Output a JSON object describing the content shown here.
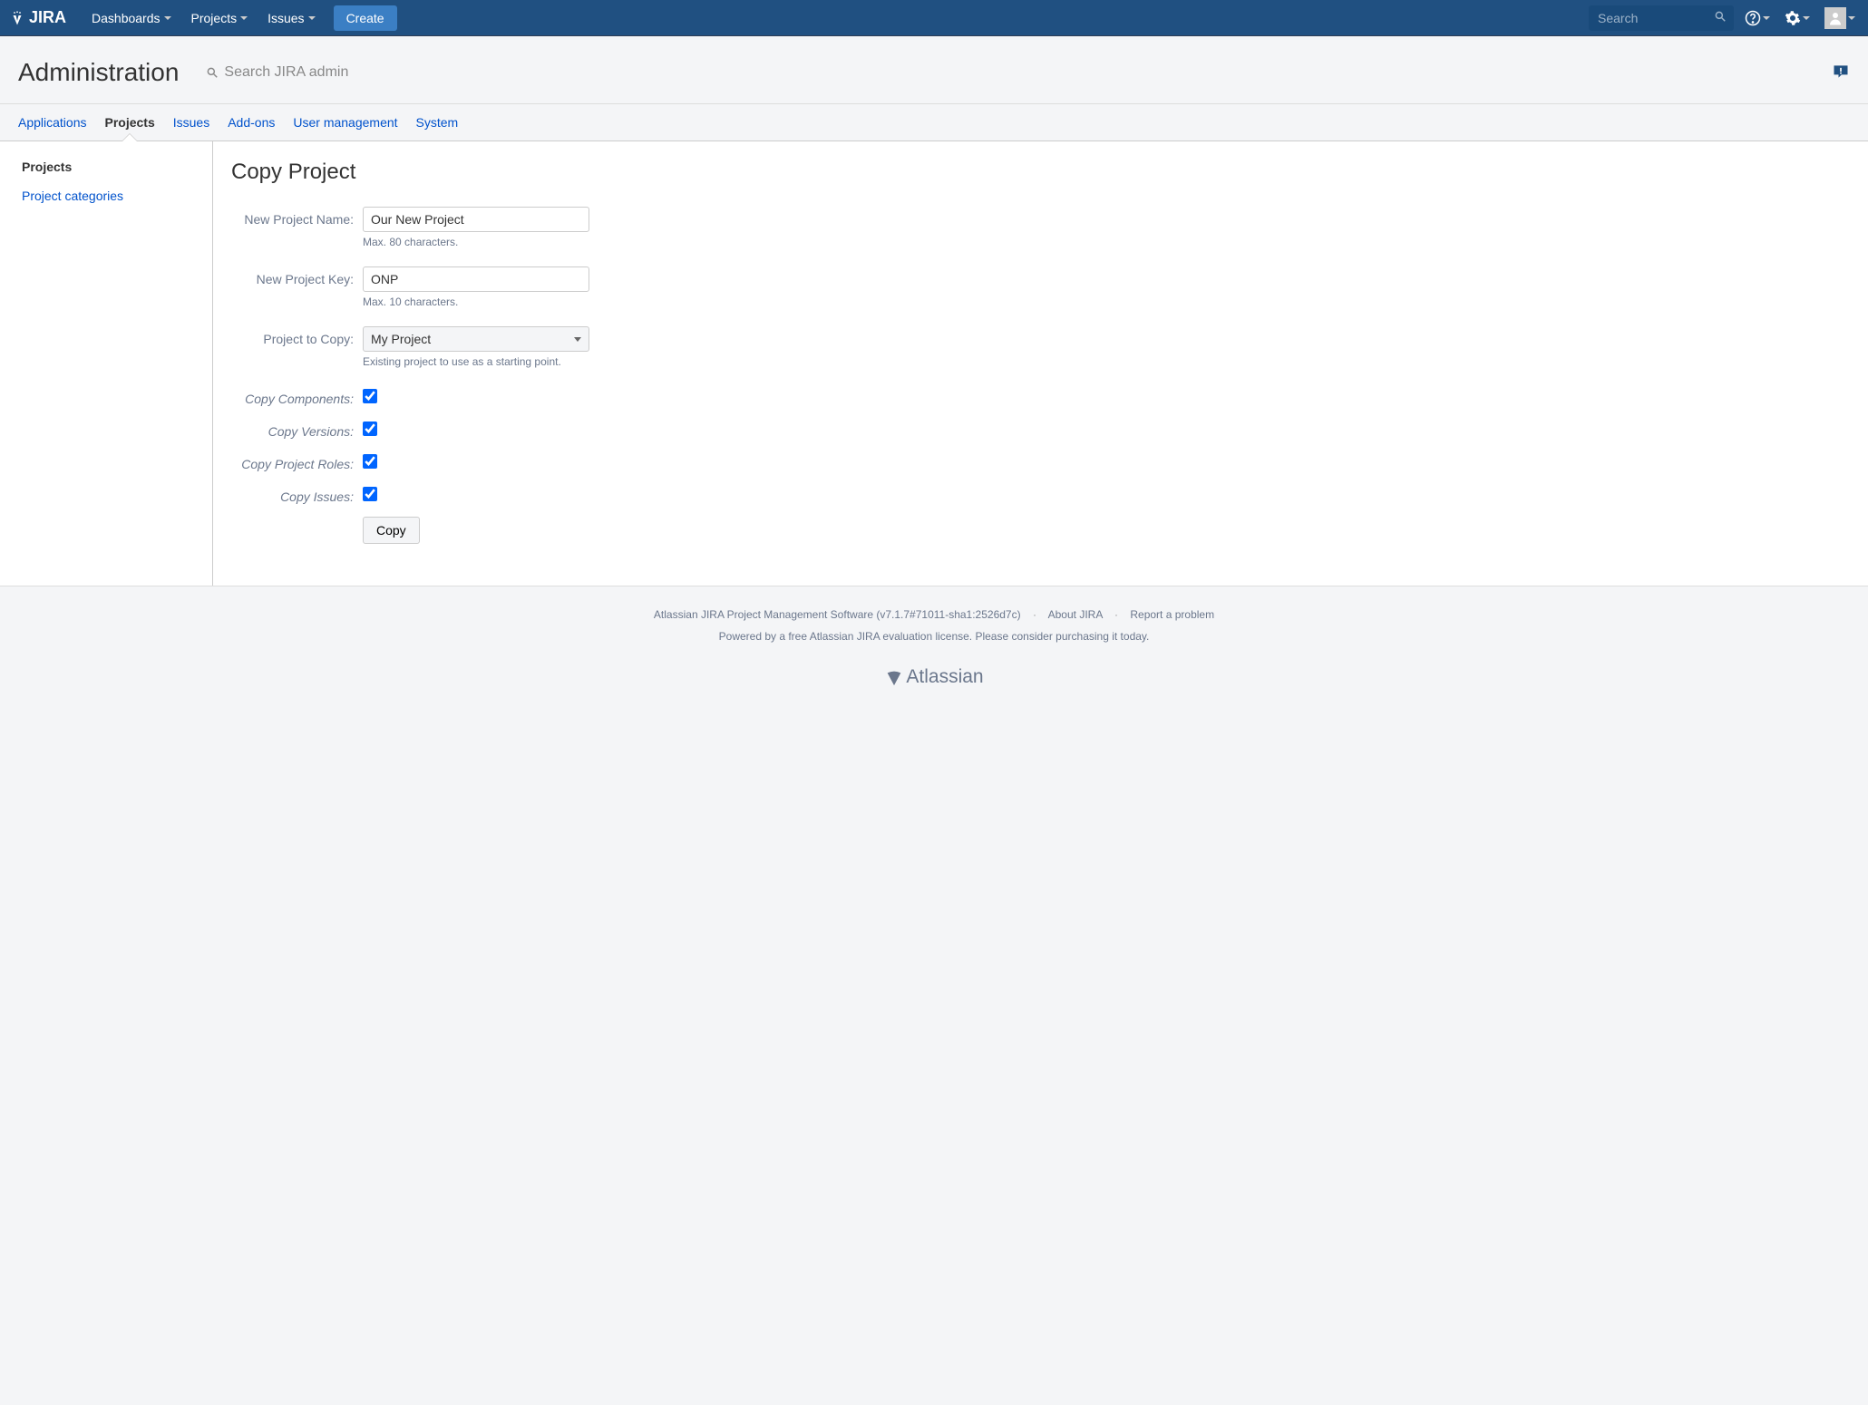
{
  "topnav": {
    "brand": "JIRA",
    "items": [
      "Dashboards",
      "Projects",
      "Issues"
    ],
    "create_label": "Create",
    "search_placeholder": "Search"
  },
  "admin": {
    "title": "Administration",
    "search_placeholder": "Search JIRA admin",
    "tabs": [
      "Applications",
      "Projects",
      "Issues",
      "Add-ons",
      "User management",
      "System"
    ],
    "active_tab_index": 1
  },
  "sidebar": {
    "heading": "Projects",
    "links": [
      "Project categories"
    ]
  },
  "page": {
    "title": "Copy Project",
    "fields": {
      "name_label": "New Project Name:",
      "name_value": "Our New Project",
      "name_hint": "Max. 80 characters.",
      "key_label": "New Project Key:",
      "key_value": "ONP",
      "key_hint": "Max. 10 characters.",
      "copy_label": "Project to Copy:",
      "copy_value": "My Project",
      "copy_hint": "Existing project to use as a starting point.",
      "components_label": "Copy Components:",
      "versions_label": "Copy Versions:",
      "roles_label": "Copy Project Roles:",
      "issues_label": "Copy Issues:",
      "submit_label": "Copy"
    }
  },
  "footer": {
    "product": "Atlassian JIRA Project Management Software (v7.1.7#71011-sha1:2526d7c)",
    "about": "About JIRA",
    "report": "Report a problem",
    "license": "Powered by a free Atlassian JIRA evaluation license. Please consider purchasing it today.",
    "vendor": "Atlassian"
  }
}
